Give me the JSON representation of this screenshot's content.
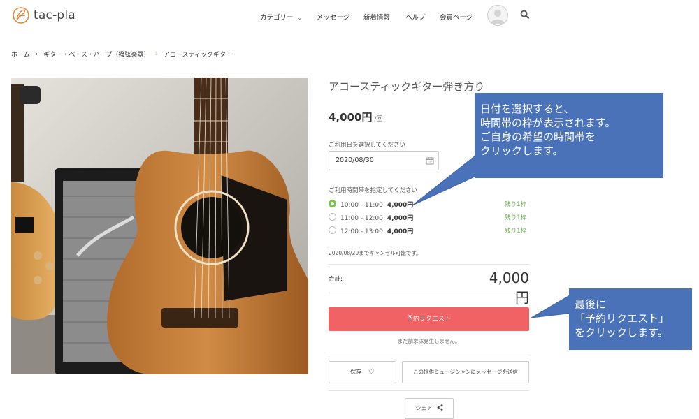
{
  "header": {
    "logo_text": "tac-pla",
    "nav": [
      {
        "label": "カテゴリー",
        "has_dropdown": true
      },
      {
        "label": "メッセージ",
        "has_dropdown": false
      },
      {
        "label": "新着情報",
        "has_dropdown": false
      },
      {
        "label": "ヘルプ",
        "has_dropdown": false
      },
      {
        "label": "会員ページ",
        "has_dropdown": false
      }
    ],
    "icons": [
      "avatar-icon",
      "search-icon"
    ]
  },
  "breadcrumb": [
    "ホーム",
    "ギター・ベース・ハープ（撥弦楽器）",
    "アコースティックギター"
  ],
  "product": {
    "title": "アコースティックギター弾き方り",
    "price": "4,000円",
    "price_unit": "/回",
    "date_label": "ご利用日を選択してください",
    "date_value": "2020/08/30",
    "time_label": "ご利用時間帯を指定してください",
    "slots": [
      {
        "time": "10:00 - 11:00",
        "price": "4,000円",
        "remaining": "残り1枠",
        "selected": true
      },
      {
        "time": "11:00 - 12:00",
        "price": "4,000円",
        "remaining": "残り1枠",
        "selected": false
      },
      {
        "time": "12:00 - 13:00",
        "price": "4,000円",
        "remaining": "残り1枠",
        "selected": false
      }
    ],
    "cancel_note": "2020/08/29までキャンセル可能です。",
    "total_label": "合計:",
    "total_value": "4,000円",
    "request_button": "予約リクエスト",
    "request_note": "まだ請求は発生しません。",
    "save_button": "保存",
    "message_button": "この提供ミュージシャンにメッセージを送信",
    "share_button": "シェア"
  },
  "annotations": {
    "callout_1": [
      "日付を選択すると、",
      "時間帯の枠が表示されます。",
      "ご自身の希望の時間帯を",
      "クリックします。"
    ],
    "callout_2": [
      "最後に",
      "「予約リクエスト」",
      "をクリックします。"
    ]
  },
  "colors": {
    "accent_red": "#f06264",
    "callout_blue": "#4a72b9",
    "radio_selected": "#7cc54a",
    "remaining_green": "#6aa84f",
    "breadcrumb_sep_gold": "#d4a93c"
  }
}
